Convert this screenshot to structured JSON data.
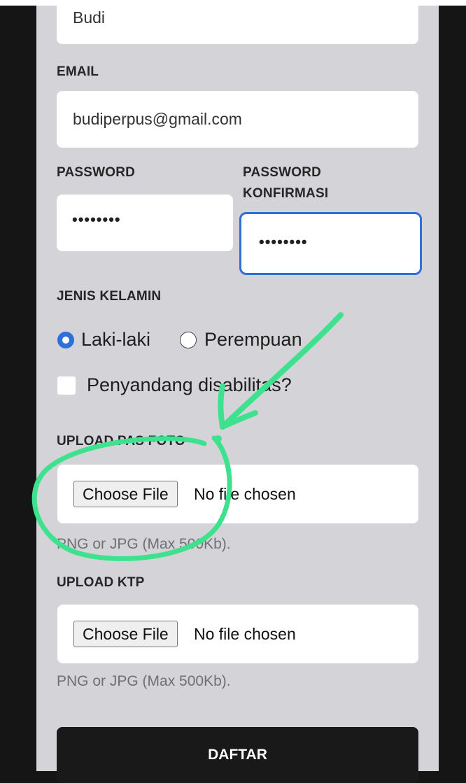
{
  "form": {
    "name_value": "Budi",
    "email_label": "EMAIL",
    "email_value": "budiperpus@gmail.com",
    "password_label": "PASSWORD",
    "password_value": "••••••••",
    "password_confirm_label_line1": "PASSWORD",
    "password_confirm_label_line2": "KONFIRMASI",
    "password_confirm_value": "••••••••",
    "gender_label": "JENIS KELAMIN",
    "gender_options": [
      "Laki-laki",
      "Perempuan"
    ],
    "gender_selected": "Laki-laki",
    "disability_label": "Penyandang disabilitas?",
    "disability_checked": false,
    "photo_label": "UPLOAD PAS FOTO",
    "photo_button": "Choose File",
    "photo_status": "No file chosen",
    "photo_hint": "PNG or JPG (Max 500Kb).",
    "ktp_label": "UPLOAD KTP",
    "ktp_button": "Choose File",
    "ktp_status": "No file chosen",
    "ktp_hint": "PNG or JPG (Max 500Kb).",
    "submit_label": "DAFTAR"
  },
  "colors": {
    "panel_background": "#d4d4d8",
    "focus_border": "#2f6fd8",
    "radio_selected": "#2f6fd8",
    "annotation": "#3ee28e",
    "submit_background": "#191919"
  },
  "annotation": {
    "arrow_icon": "hand-drawn-arrow",
    "circle_icon": "hand-drawn-circle"
  }
}
